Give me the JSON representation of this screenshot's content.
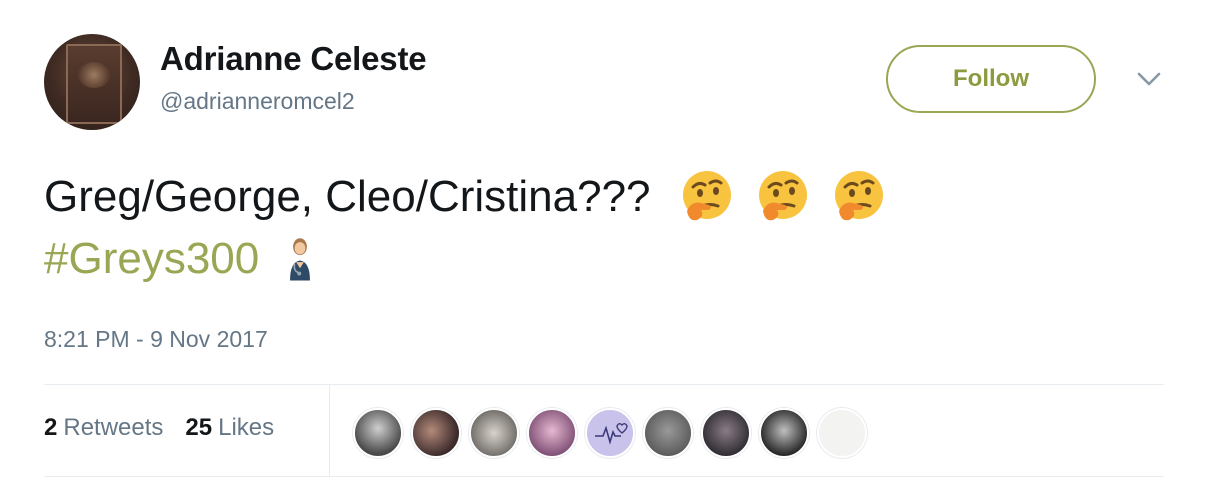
{
  "user": {
    "name": "Adrianne Celeste",
    "handle": "@adrianneromcel2",
    "avatar_icon": "avatar-book-cover"
  },
  "follow_button": {
    "label": "Follow",
    "color": "#9aa653"
  },
  "menu": {
    "icon": "chevron-down-icon"
  },
  "tweet": {
    "line1": "Greg/George, Cleo/Cristina???",
    "hashtag": "#Greys300",
    "emojis": [
      "thinking-face",
      "thinking-face",
      "thinking-face",
      "health-worker"
    ],
    "timestamp": "8:21 PM - 9 Nov 2017"
  },
  "stats": {
    "retweets_count": "2",
    "retweets_label": "Retweets",
    "likes_count": "25",
    "likes_label": "Likes"
  },
  "likers_count_shown": 9
}
